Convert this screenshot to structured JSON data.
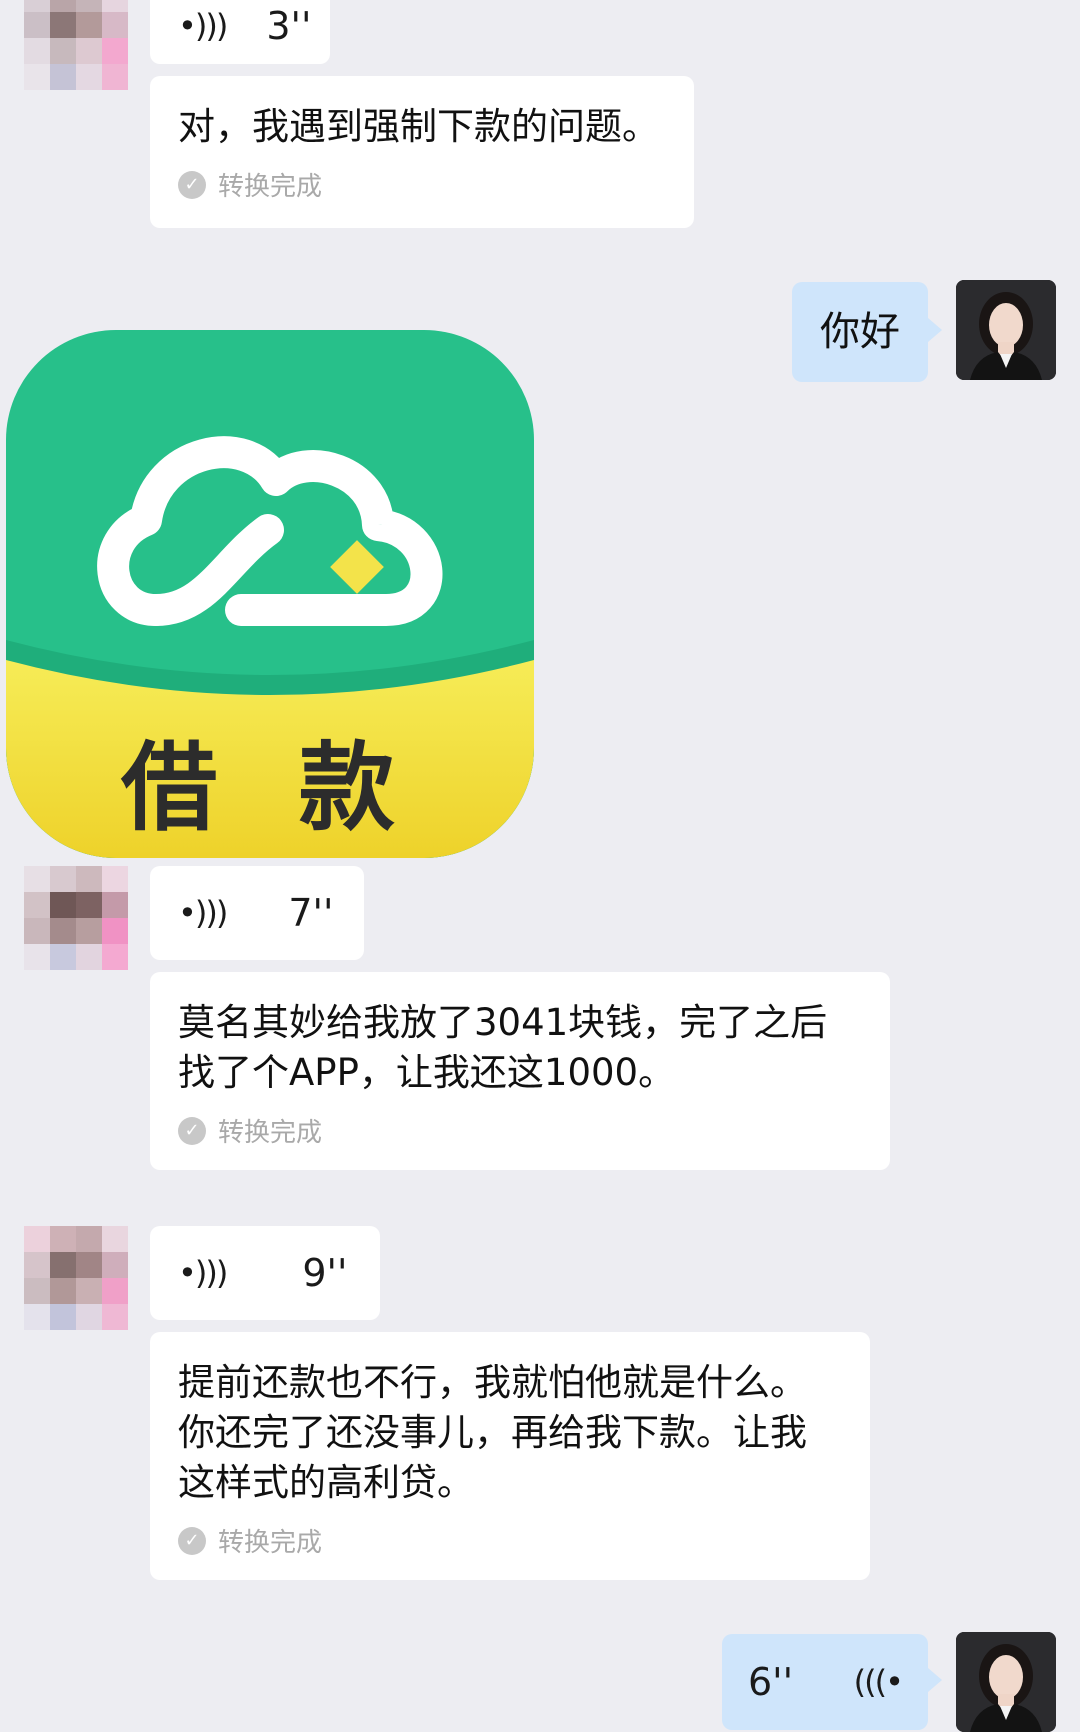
{
  "messages": {
    "m1_voice_duration": "3''",
    "m2_text": "对，我遇到强制下款的问题。",
    "m2_status": "转换完成",
    "m3_text": "你好",
    "m4_image_caption": "借 款",
    "m5_voice_duration": "7''",
    "m6_text": "莫名其妙给我放了3041块钱，完了之后\n找了个APP，让我还这1000。",
    "m6_status": "转换完成",
    "m7_voice_duration": "9''",
    "m8_text": "提前还款也不行，我就怕他就是什么。\n你还完了还没事儿，再给我下款。让我\n这样式的高利贷。",
    "m8_status": "转换完成",
    "m9_voice_duration": "6''"
  },
  "icons": {
    "voice_in": "voice-wave-icon",
    "voice_out": "voice-wave-icon",
    "check": "check-circle-icon",
    "app": "cloud-app-icon"
  },
  "colors": {
    "background": "#ededf2",
    "bubble_incoming": "#ffffff",
    "bubble_outgoing": "#cfe5fb",
    "app_green": "#27c08a",
    "app_yellow": "#f2e046"
  }
}
